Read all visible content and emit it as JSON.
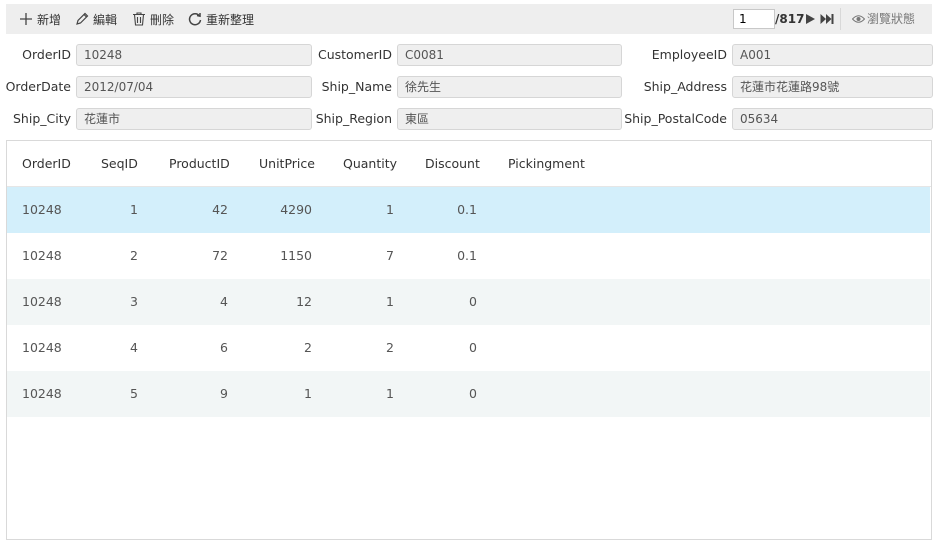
{
  "toolbar": {
    "add_label": "新增",
    "edit_label": "編輯",
    "delete_label": "刪除",
    "refresh_label": "重新整理",
    "page_value": "1",
    "page_total": "/817",
    "browse_label": "瀏覽狀態"
  },
  "form": {
    "order_id": {
      "label": "OrderID",
      "value": "10248"
    },
    "customer_id": {
      "label": "CustomerID",
      "value": "C0081"
    },
    "employee_id": {
      "label": "EmployeeID",
      "value": "A001"
    },
    "order_date": {
      "label": "OrderDate",
      "value": "2012/07/04"
    },
    "ship_name": {
      "label": "Ship_Name",
      "value": "徐先生"
    },
    "ship_address": {
      "label": "Ship_Address",
      "value": "花蓮市花蓮路98號"
    },
    "ship_city": {
      "label": "Ship_City",
      "value": "花蓮市"
    },
    "ship_region": {
      "label": "Ship_Region",
      "value": "東區"
    },
    "ship_postal_code": {
      "label": "Ship_PostalCode",
      "value": "05634"
    }
  },
  "grid": {
    "columns": [
      "OrderID",
      "SeqID",
      "ProductID",
      "UnitPrice",
      "Quantity",
      "Discount",
      "Pickingment"
    ],
    "selected_row_index": 0,
    "rows": [
      [
        "10248",
        "1",
        "42",
        "4290",
        "1",
        "0.1",
        ""
      ],
      [
        "10248",
        "2",
        "72",
        "1150",
        "7",
        "0.1",
        ""
      ],
      [
        "10248",
        "3",
        "4",
        "12",
        "1",
        "0",
        ""
      ],
      [
        "10248",
        "4",
        "6",
        "2",
        "2",
        "0",
        ""
      ],
      [
        "10248",
        "5",
        "9",
        "1",
        "1",
        "0",
        ""
      ]
    ]
  },
  "colors": {
    "toolbar_bg": "#eeeeee",
    "selected_row": "#d3effb",
    "alt_row": "#f2f6f6",
    "input_bg": "#efefef"
  },
  "icons": [
    "plus-icon",
    "pencil-icon",
    "trash-icon",
    "refresh-icon",
    "play-icon",
    "last-page-icon",
    "eye-icon"
  ]
}
